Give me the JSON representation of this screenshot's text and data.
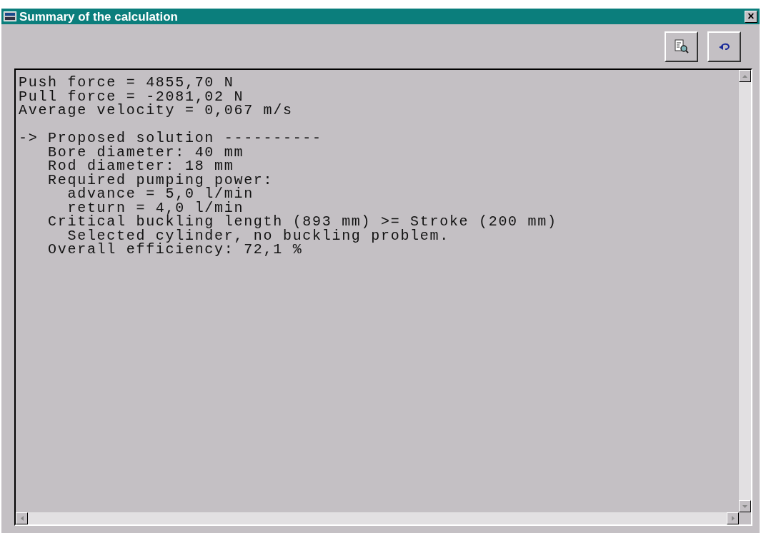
{
  "window": {
    "title": "Summary of the calculation",
    "close": "×"
  },
  "toolbar": {
    "buttons": [
      {
        "kind": "preview"
      },
      {
        "kind": "undo"
      }
    ]
  },
  "report": {
    "blocks": [
      {
        "lines": [
          "Push force = 4855,70 N",
          "Pull force = -2081,02 N",
          "Average velocity = 0,067 m/s"
        ]
      },
      {
        "lines": [
          "-> Proposed solution ----------",
          "   Bore diameter: 40 mm",
          "   Rod diameter: 18 mm",
          "   Required pumping power:",
          "     advance = 5,0 l/min",
          "     return = 4,0 l/min",
          "   Critical buckling length (893 mm) >= Stroke (200 mm)",
          "     Selected cylinder, no buckling problem.",
          "   Overall efficiency: 72,1 %"
        ]
      }
    ]
  }
}
